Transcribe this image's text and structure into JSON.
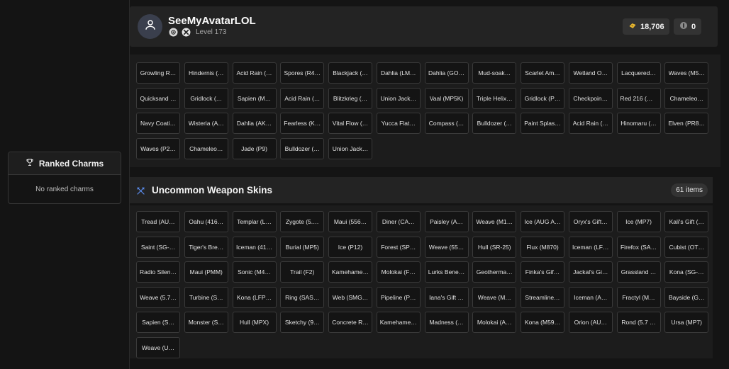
{
  "profile": {
    "username": "SeeMyAvatarLOL",
    "level": "Level 173",
    "platform_icons": [
      "steam-icon",
      "xbox-icon"
    ],
    "credits": "18,706",
    "secondary_count": "0"
  },
  "ranked_charms": {
    "title": "Ranked Charms",
    "empty_text": "No ranked charms"
  },
  "rare_skins": {
    "items": [
      "Growling R…",
      "Hindernis (…",
      "Acid Rain (…",
      "Spores (R4…",
      "Blackjack (…",
      "Dahlia (LM…",
      "Dahlia (GO…",
      "Mud-soak…",
      "Scarlet Am…",
      "Wetland O…",
      "Lacquered…",
      "Waves (M5…",
      "Quicksand …",
      "Gridlock (…",
      "Sapien (M…",
      "Acid Rain (…",
      "Blitzkrieg (…",
      "Union Jack…",
      "Vaal (MP5K)",
      "Triple Helix…",
      "Gridlock (P…",
      "Checkpoin…",
      "Red 216 (G…",
      "Chameleo…",
      "Navy Coati…",
      "Wisteria (A…",
      "Dahlia (AK…",
      "Fearless (K…",
      "Vital Flow (…",
      "Yucca Flat…",
      "Compass (…",
      "Bulldozer (…",
      "Paint Splas…",
      "Acid Rain (…",
      "Hinomaru (…",
      "Elven (PR8…",
      "Waves (P2…",
      "Chameleo…",
      "Jade (P9)",
      "Bulldozer (…",
      "Union Jack…"
    ]
  },
  "uncommon_skins": {
    "title": "Uncommon Weapon Skins",
    "count": "61 items",
    "items": [
      "Tread (AU…",
      "Oahu (416…",
      "Templar (L…",
      "Zygote (5.…",
      "Maui (556…",
      "Diner (CA…",
      "Paisley (A…",
      "Weave (M1…",
      "Ice (AUG A…",
      "Oryx's Gift…",
      "Ice (MP7)",
      "Kali's Gift (…",
      "Saint (SG-…",
      "Tiger's Bre…",
      "Iceman (41…",
      "Burial (MP5)",
      "Ice (P12)",
      "Forest (SP…",
      "Weave (55…",
      "Hull (SR-25)",
      "Flux (M870)",
      "Iceman (LF…",
      "Firefox (SA…",
      "Cubist (OT…",
      "Radio Silen…",
      "Maui (PMM)",
      "Sonic (M4…",
      "Trail (F2)",
      "Kamehame…",
      "Molokai (F…",
      "Lurks Bene…",
      "Geotherma…",
      "Finka's Gif…",
      "Jackal's Gi…",
      "Grassland …",
      "Kona (SG-…",
      "Weave (5.7…",
      "Turbine (S…",
      "Kona (LFP…",
      "Ring (SAS…",
      "Web (SMG…",
      "Pipeline (P…",
      "Iana's Gift …",
      "Weave (M…",
      "Streamline…",
      "Iceman (A…",
      "Fractyl (M…",
      "Bayside (G…",
      "Sapien (S…",
      "Monster (S…",
      "Hull (MPX)",
      "Sketchy (9…",
      "Concrete R…",
      "Kamehame…",
      "Madness (…",
      "Molokai (A…",
      "Kona (M59…",
      "Orion (AU…",
      "Rond (5.7 …",
      "Ursa (MP7)",
      "Weave (U…"
    ]
  }
}
